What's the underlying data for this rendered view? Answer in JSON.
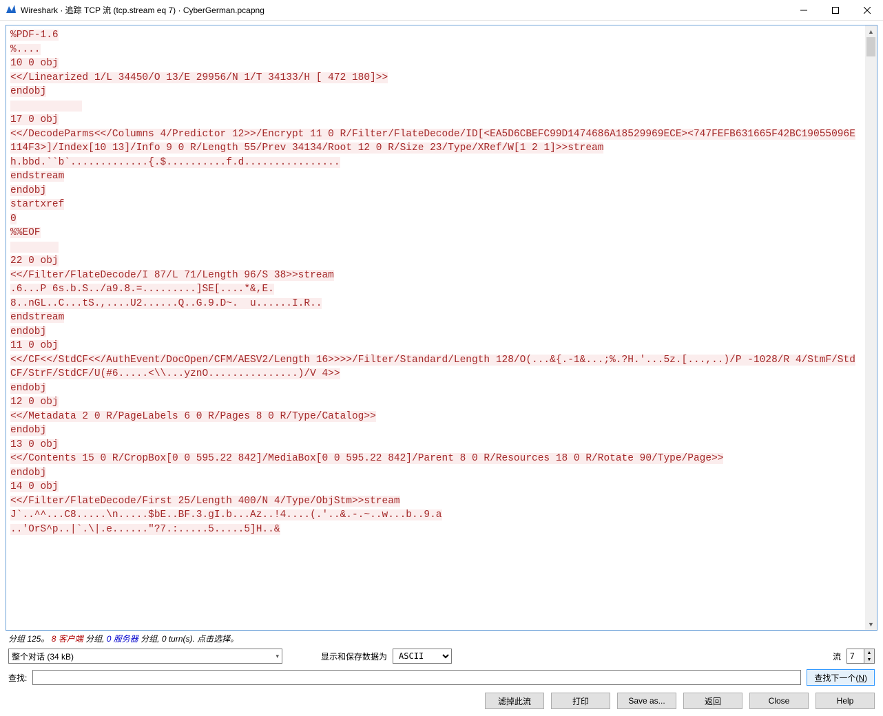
{
  "window": {
    "title": "Wireshark · 追踪 TCP 流 (tcp.stream eq 7) · CyberGerman.pcapng"
  },
  "stream_content": "%PDF-1.6\n%....\n10 0 obj\n<</Linearized 1/L 34450/O 13/E 29956/N 1/T 34133/H [ 472 180]>>\nendobj\n            \n17 0 obj\n<</DecodeParms<</Columns 4/Predictor 12>>/Encrypt 11 0 R/Filter/FlateDecode/ID[<EA5D6CBEFC99D1474686A18529969ECE><747FEFB631665F42BC19055096E114F3>]/Index[10 13]/Info 9 0 R/Length 55/Prev 34134/Root 12 0 R/Size 23/Type/XRef/W[1 2 1]>>stream\nh.bbd.``b`.............{.$..........f.d................\nendstream\nendobj\nstartxref\n0\n%%EOF\n        \n22 0 obj\n<</Filter/FlateDecode/I 87/L 71/Length 96/S 38>>stream\n.6...P 6s.b.S../a9.8.=.........]SE[....*&,E.\n8..nGL..C...tS.,....U2......Q..G.9.D~.  u......I.R..\nendstream\nendobj\n11 0 obj\n<</CF<</StdCF<</AuthEvent/DocOpen/CFM/AESV2/Length 16>>>>/Filter/Standard/Length 128/O(...&{.-1&...;%.?H.'...5z.[...,..)/P -1028/R 4/StmF/StdCF/StrF/StdCF/U(#6.....<\\\\...yznO...............)/V 4>>\nendobj\n12 0 obj\n<</Metadata 2 0 R/PageLabels 6 0 R/Pages 8 0 R/Type/Catalog>>\nendobj\n13 0 obj\n<</Contents 15 0 R/CropBox[0 0 595.22 842]/MediaBox[0 0 595.22 842]/Parent 8 0 R/Resources 18 0 R/Rotate 90/Type/Page>>\nendobj\n14 0 obj\n<</Filter/FlateDecode/First 25/Length 400/N 4/Type/ObjStm>>stream\nJ`..^^...C8.....\\n.....$bE..BF.3.gI.b...Az..!4....(.'..&.-.~..w...b..9.a\n..'OrS^p..|`.\\|.e......\"?7.:.....5.....5]H..&\n",
  "status": {
    "pkts_label": "分组 125。",
    "client_pkts": "8",
    "client_label": "客户端",
    "mid1": " 分组, ",
    "server_pkts": "0",
    "server_label": "服务器",
    "mid2": " 分组, ",
    "turns": "0 turn(s). 点击选择。"
  },
  "controls": {
    "conversation_selected": "整个对话 (34 kB)",
    "display_save_label": "显示和保存数据为",
    "ascii_selected": "ASCII",
    "stream_label": "流",
    "stream_value": "7",
    "find_label": "查找:",
    "find_value": ""
  },
  "buttons": {
    "find_next": "查找下一个(N)",
    "filter_out": "滤掉此流",
    "print": "打印",
    "save_as": "Save as...",
    "back": "返回",
    "close": "Close",
    "help": "Help"
  },
  "colors": {
    "client_text": "#a52a2a",
    "client_bg": "#fbeded",
    "border_accent": "#6ea2d8"
  }
}
